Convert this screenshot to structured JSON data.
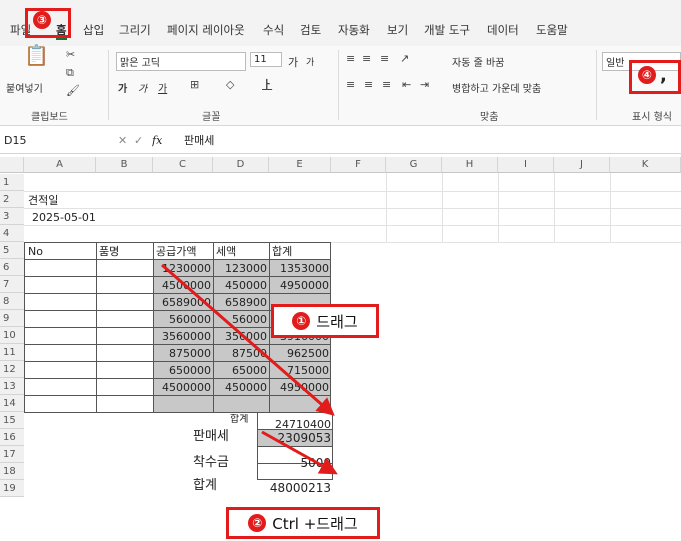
{
  "tabs": [
    "파일",
    "홈",
    "삽입",
    "그리기",
    "페이지 레이아웃",
    "수식",
    "검토",
    "자동화",
    "보기",
    "개발 도구",
    "데이터",
    "도움말"
  ],
  "ribbon": {
    "clipboard": {
      "paste": "붙여넣기",
      "label": "클립보드"
    },
    "font": {
      "name": "맑은 고딕",
      "size": "11",
      "grow": "가",
      "shrink": "가",
      "bold": "가",
      "italic": "가",
      "underline": "가",
      "label": "글꼴"
    },
    "align": {
      "wrap": "자동 줄 바꿈",
      "merge": "병합하고 가운데 맞춤",
      "label": "맞춤"
    },
    "number": {
      "format": "일반",
      "label": "표시 형식"
    }
  },
  "formula_bar": {
    "name_box": "D15",
    "fx": "fx",
    "value": "판매세"
  },
  "columns": [
    "A",
    "B",
    "C",
    "D",
    "E",
    "F",
    "G",
    "H",
    "I",
    "J",
    "K"
  ],
  "rows": [
    "1",
    "2",
    "3",
    "4",
    "5",
    "6",
    "7",
    "8",
    "9",
    "10",
    "11",
    "12",
    "13",
    "14",
    "15",
    "16",
    "17",
    "18",
    "19"
  ],
  "cells": {
    "title": "견적일",
    "date": "2025-05-01",
    "h_no": "No",
    "h_item": "품명",
    "h_supply": "공급가액",
    "h_tax": "세액",
    "h_total": "합계",
    "r6": [
      "1230000",
      "123000",
      "1353000"
    ],
    "r7": [
      "4500000",
      "450000",
      "4950000"
    ],
    "r8": [
      "6589000",
      "658900",
      ""
    ],
    "r9": [
      "560000",
      "56000",
      ""
    ],
    "r10": [
      "3560000",
      "356000",
      "3916000"
    ],
    "r11": [
      "875000",
      "87500",
      "962500"
    ],
    "r12": [
      "650000",
      "65000",
      "715000"
    ],
    "r13": [
      "4500000",
      "450000",
      "4950000"
    ],
    "sum_label": "합계",
    "sum_value": "24710400",
    "sales_tax_label": "판매세",
    "sales_tax_value": "2309053",
    "deposit_label": "착수금",
    "deposit_value": "5000",
    "grand_label": "합계",
    "grand_value": "48000213"
  },
  "annotations": {
    "c1_num": "①",
    "c1_text": "드래그",
    "c2_num": "②",
    "c2_text": "Ctrl +드래그",
    "c3": "③",
    "c4": "④",
    "comma": ","
  },
  "colors": {
    "accent": "#e21b1b",
    "selection": "#c8c8c8"
  }
}
